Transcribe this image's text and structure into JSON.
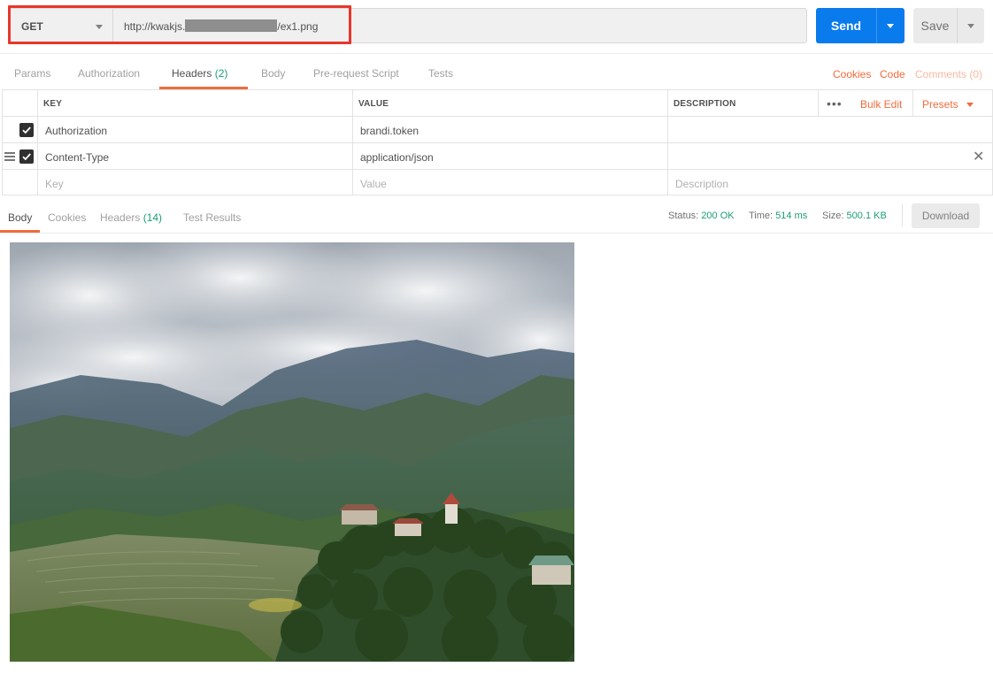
{
  "request": {
    "method": "GET",
    "url_prefix": "http://kwakjs.",
    "url_suffix": "/ex1.png",
    "send_label": "Send",
    "save_label": "Save"
  },
  "request_tabs": {
    "params": "Params",
    "authorization": "Authorization",
    "headers": "Headers",
    "headers_count": "(2)",
    "body": "Body",
    "pre_request": "Pre-request Script",
    "tests": "Tests",
    "cookies": "Cookies",
    "code": "Code",
    "comments": "Comments (0)"
  },
  "headers_table": {
    "columns": {
      "key": "KEY",
      "value": "VALUE",
      "description": "DESCRIPTION"
    },
    "bulk_edit": "Bulk Edit",
    "presets": "Presets",
    "more_icon": "•••",
    "rows": [
      {
        "key": "Authorization",
        "value": "brandi.token",
        "checked": true
      },
      {
        "key": "Content-Type",
        "value": "application/json",
        "checked": true
      }
    ],
    "placeholder": {
      "key": "Key",
      "value": "Value",
      "description": "Description"
    }
  },
  "response": {
    "tabs": {
      "body": "Body",
      "cookies": "Cookies",
      "headers": "Headers",
      "headers_count": "(14)",
      "test_results": "Test Results"
    },
    "status_label": "Status:",
    "status_value": "200 OK",
    "time_label": "Time:",
    "time_value": "514 ms",
    "size_label": "Size:",
    "size_value": "500.1 KB",
    "download_label": "Download"
  },
  "colors": {
    "accent_orange": "#f26b3a",
    "send_blue": "#097bed",
    "success_green": "#1a9f6e",
    "highlight_red": "#e8362b"
  },
  "icons": [
    "chevron-down-icon",
    "checkbox-checked-icon",
    "drag-handle-icon",
    "more-icon",
    "close-icon"
  ]
}
